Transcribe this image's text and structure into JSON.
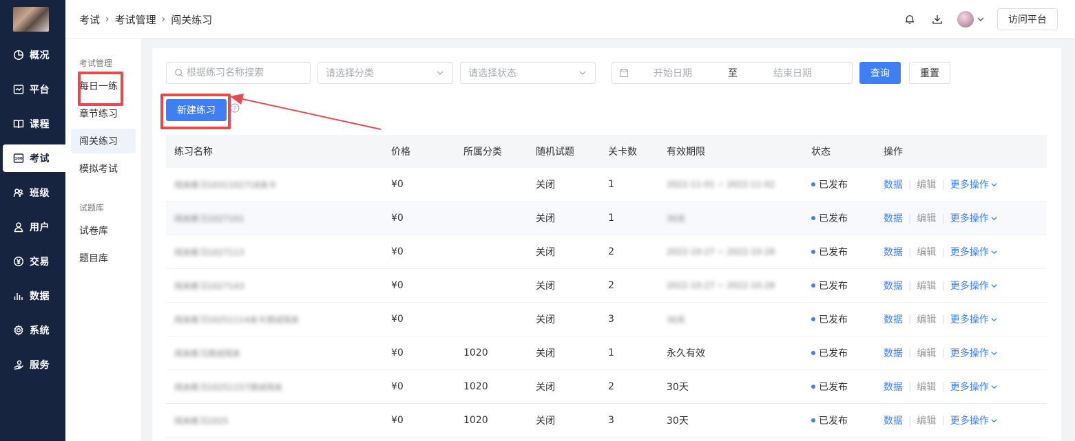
{
  "nav": {
    "items": [
      {
        "label": "概况",
        "icon": "pie-chart-icon"
      },
      {
        "label": "平台",
        "icon": "platform-icon"
      },
      {
        "label": "课程",
        "icon": "book-icon"
      },
      {
        "label": "考试",
        "icon": "exam-icon"
      },
      {
        "label": "班级",
        "icon": "group-icon"
      },
      {
        "label": "用户",
        "icon": "user-icon"
      },
      {
        "label": "交易",
        "icon": "yen-icon"
      },
      {
        "label": "数据",
        "icon": "bar-chart-icon"
      },
      {
        "label": "系统",
        "icon": "gear-icon"
      },
      {
        "label": "服务",
        "icon": "service-icon"
      }
    ],
    "active_index": 3
  },
  "header": {
    "breadcrumb": [
      "考试",
      "考试管理",
      "闯关练习"
    ],
    "visit_label": "访问平台"
  },
  "subnav": {
    "group1": "考试管理",
    "group1_items": [
      "每日一练",
      "章节练习",
      "闯关练习",
      "模拟考试"
    ],
    "group2": "试题库",
    "group2_items": [
      "试卷库",
      "题目库"
    ]
  },
  "filters": {
    "search_placeholder": "根据练习名称搜索",
    "category_placeholder": "请选择分类",
    "status_placeholder": "请选择状态",
    "date_start": "开始日期",
    "date_to": "至",
    "date_end": "结束日期",
    "query_label": "查询",
    "reset_label": "重置"
  },
  "new_button_label": "新建练习",
  "table": {
    "columns": [
      "练习名称",
      "价格",
      "所属分类",
      "随机试题",
      "关卡数",
      "有效期限",
      "状态",
      "操作"
    ],
    "rows": [
      {
        "name": "闯关练习1031102718关卡",
        "price": "¥0",
        "category": "",
        "random": "关闭",
        "levels": "1",
        "validity": "2022-11-01 ~ 2022-11-02",
        "validity_blur": true,
        "status": "已发布"
      },
      {
        "name": "闯关练习1027101",
        "price": "¥0",
        "category": "",
        "random": "关闭",
        "levels": "1",
        "validity": "30天",
        "validity_blur": true,
        "status": "已发布"
      },
      {
        "name": "闯关练习1027113",
        "price": "¥0",
        "category": "",
        "random": "关闭",
        "levels": "2",
        "validity": "2022-10-27 ~ 2022-10-28",
        "validity_blur": true,
        "status": "已发布"
      },
      {
        "name": "闯关练习1027143",
        "price": "¥0",
        "category": "",
        "random": "关闭",
        "levels": "2",
        "validity": "2022-10-27 ~ 2022-10-28",
        "validity_blur": true,
        "status": "已发布"
      },
      {
        "name": "闯关练习10251114关卡测试闯关",
        "price": "¥0",
        "category": "",
        "random": "关闭",
        "levels": "3",
        "validity": "30天",
        "validity_blur": true,
        "status": "已发布"
      },
      {
        "name": "闯关练习测试闯关",
        "price": "¥0",
        "category": "1020",
        "random": "关闭",
        "levels": "1",
        "validity": "永久有效",
        "validity_blur": false,
        "status": "已发布"
      },
      {
        "name": "闯关练习10251157测试闯关",
        "price": "¥0",
        "category": "1020",
        "random": "关闭",
        "levels": "2",
        "validity": "30天",
        "validity_blur": false,
        "status": "已发布"
      },
      {
        "name": "闯关练习1025",
        "price": "¥0",
        "category": "1020",
        "random": "关闭",
        "levels": "3",
        "validity": "30天",
        "validity_blur": false,
        "status": "已发布"
      }
    ],
    "ops": {
      "data": "数据",
      "edit": "编辑",
      "more": "更多操作"
    }
  },
  "colors": {
    "primary": "#3e7ff5",
    "nav_bg": "#172440",
    "annotation": "#e8484e"
  }
}
